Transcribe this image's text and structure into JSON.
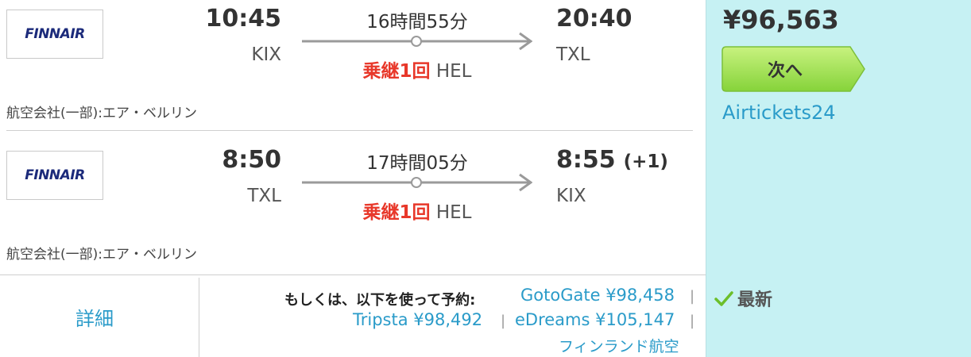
{
  "outbound": {
    "airline_logo": "FINNAIR",
    "depart_time": "10:45",
    "depart_airport": "KIX",
    "duration": "16時間55分",
    "stops_label": "乗継1回",
    "stop_airport": "HEL",
    "arrive_time": "20:40",
    "arrive_airport": "TXL",
    "day_offset": "",
    "airline_note": "航空会社(一部):エア・ベルリン"
  },
  "inbound": {
    "airline_logo": "FINNAIR",
    "depart_time": "8:50",
    "depart_airport": "TXL",
    "duration": "17時間05分",
    "stops_label": "乗継1回",
    "stop_airport": "HEL",
    "arrive_time": "8:55",
    "arrive_airport": "KIX",
    "day_offset": "(+1)",
    "airline_note": "航空会社(一部):エア・ベルリン"
  },
  "footer": {
    "details_label": "詳細",
    "book_via_label": "もしくは、以下を使って予約:",
    "alternatives": [
      {
        "name": "GotoGate",
        "price": "¥98,458"
      },
      {
        "name": "Tripsta",
        "price": "¥98,492"
      },
      {
        "name": "eDreams",
        "price": "¥105,147"
      },
      {
        "name": "フィンランド航空",
        "price": ""
      }
    ],
    "separator": "|"
  },
  "offer": {
    "price": "¥96,563",
    "next_label": "次へ",
    "provider": "Airtickets24",
    "latest_label": "最新"
  },
  "colors": {
    "accent_link": "#2a9bc9",
    "stops_red": "#e8382a",
    "right_panel_bg": "#c6f1f3",
    "button_green": "#9be051",
    "check_green": "#6cbf2a"
  },
  "icons": [
    "arrow-right-icon",
    "check-icon"
  ]
}
